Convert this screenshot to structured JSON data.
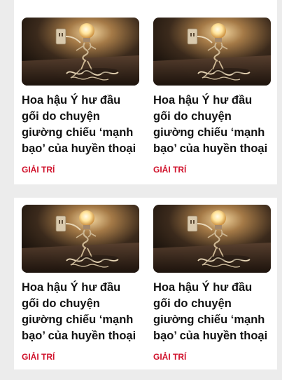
{
  "articles": [
    {
      "title": "Hoa hậu Ý hư đầu gối do chuyện giường chiếu ‘mạnh bạo’ của huyền thoại",
      "category": "GIẢI TRÍ",
      "image": "lightbulb-photo"
    },
    {
      "title": "Hoa hậu Ý hư đầu gối do chuyện giường chiếu ‘mạnh bạo’ của huyền thoại",
      "category": "GIẢI TRÍ",
      "image": "lightbulb-photo"
    },
    {
      "title": "Hoa hậu Ý hư đầu gối do chuyện giường chiếu ‘mạnh bạo’ của huyền thoại",
      "category": "GIẢI TRÍ",
      "image": "lightbulb-photo"
    },
    {
      "title": "Hoa hậu Ý hư đầu gối do chuyện giường chiếu ‘mạnh bạo’ của huyền thoại",
      "category": "GIẢI TRÍ",
      "image": "lightbulb-photo"
    }
  ],
  "colors": {
    "category": "#d0112b",
    "title": "#111111",
    "panel": "#ffffff",
    "background": "#ececec"
  }
}
